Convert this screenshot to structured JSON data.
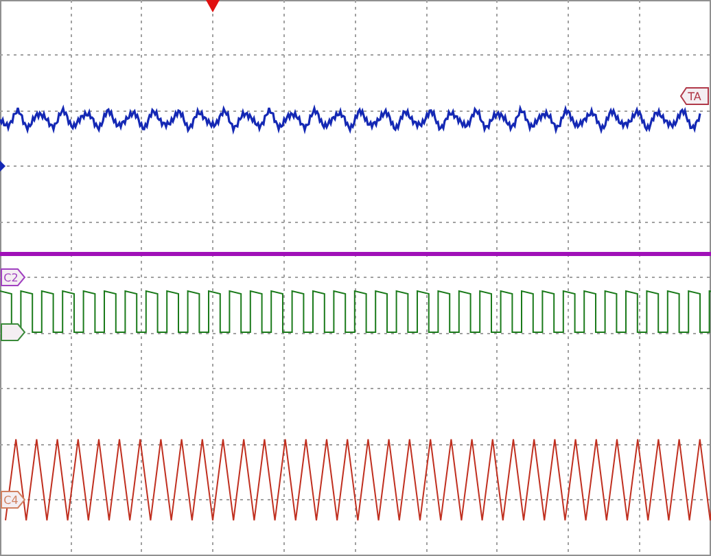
{
  "trigger": {
    "color": "#e01010"
  },
  "traces": [
    {
      "kind": "sine",
      "color": "#1428b4",
      "marker": {
        "label": "TA",
        "kind": "right",
        "color": "#b03848"
      }
    },
    {
      "kind": "flat",
      "color": "#a010b8",
      "marker": {
        "label": "C2",
        "kind": "left",
        "color": "#a040c0"
      }
    },
    {
      "kind": "square",
      "color": "#1a7a1a",
      "marker": {
        "kind": "left",
        "color": "#3a8a3a"
      }
    },
    {
      "kind": "triangle",
      "color": "#c03020",
      "marker": {
        "label": "C4",
        "kind": "left",
        "color": "#d08060"
      }
    }
  ],
  "offset_marker": {
    "color": "#1428b4"
  }
}
